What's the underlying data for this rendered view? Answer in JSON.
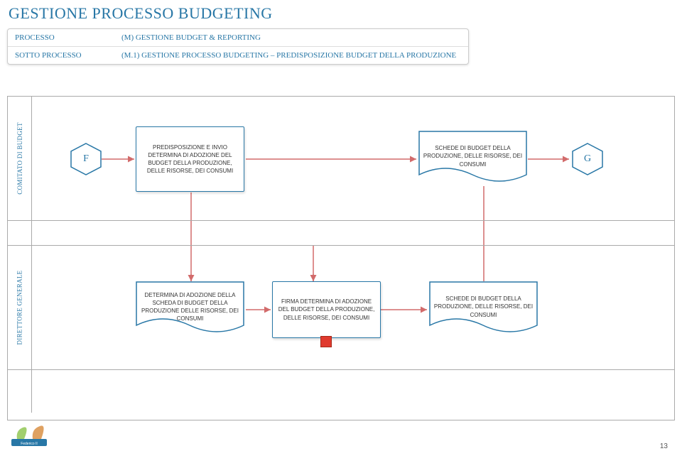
{
  "title": "GESTIONE PROCESSO BUDGETING",
  "header": {
    "processo_label": "PROCESSO",
    "processo_value": "(M) GESTIONE BUDGET & REPORTING",
    "sotto_label": "SOTTO PROCESSO",
    "sotto_value": "(M.1) GESTIONE PROCESSO BUDGETING – PREDISPOSIZIONE BUDGET DELLA PRODUZIONE"
  },
  "lanes": {
    "comitato": "COMITATO DI BUDGET",
    "direttore": "DIRETTORE GENERALE"
  },
  "nodes": {
    "F": "F",
    "G": "G",
    "predisposizione": "PREDISPOSIZIONE E INVIO DETERMINA DI ADOZIONE DEL BUDGET DELLA PRODUZIONE, DELLE RISORSE, DEI CONSUMI",
    "schede1": "SCHEDE DI BUDGET DELLA PRODUZIONE, DELLE RISORSE, DEI CONSUMI",
    "determina": "DETERMINA DI ADOZIONE DELLA SCHEDA DI BUDGET DELLA PRODUZIONE DELLE RISORSE, DEI CONSUMI",
    "firma": "FIRMA DETERMINA DI ADOZIONE DEL BUDGET DELLA PRODUZIONE, DELLE RISORSE, DEI CONSUMI",
    "schede2": "SCHEDE DI BUDGET DELLA PRODUZIONE, DELLE RISORSE, DEI CONSUMI"
  },
  "page_number": "13",
  "colors": {
    "accent": "#2877a6",
    "arrow": "#d26b6b"
  }
}
